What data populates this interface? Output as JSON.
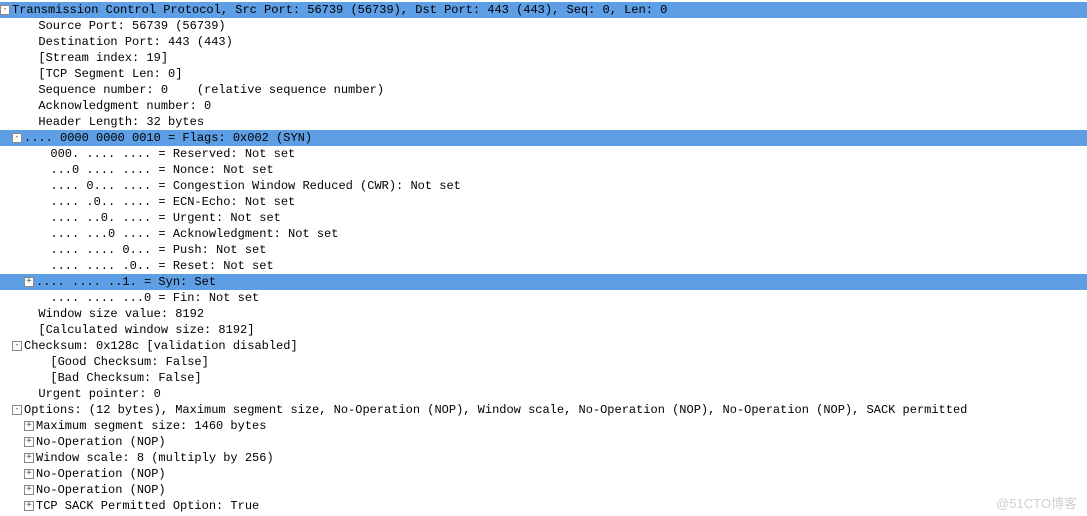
{
  "highlight_color": "#5d9ee4",
  "watermark": "@51CTO博客",
  "rows": [
    {
      "id": "tcp-header",
      "indent": 0,
      "box": "-",
      "hl": true,
      "text": "Transmission Control Protocol, Src Port: 56739 (56739), Dst Port: 443 (443), Seq: 0, Len: 0"
    },
    {
      "id": "src-port",
      "indent": 1,
      "box": "",
      "hl": false,
      "text": "  Source Port: 56739 (56739)"
    },
    {
      "id": "dst-port",
      "indent": 1,
      "box": "",
      "hl": false,
      "text": "  Destination Port: 443 (443)"
    },
    {
      "id": "stream-index",
      "indent": 1,
      "box": "",
      "hl": false,
      "text": "  [Stream index: 19]"
    },
    {
      "id": "seg-len",
      "indent": 1,
      "box": "",
      "hl": false,
      "text": "  [TCP Segment Len: 0]"
    },
    {
      "id": "seq-num",
      "indent": 1,
      "box": "",
      "hl": false,
      "text": "  Sequence number: 0    (relative sequence number)"
    },
    {
      "id": "ack-num",
      "indent": 1,
      "box": "",
      "hl": false,
      "text": "  Acknowledgment number: 0"
    },
    {
      "id": "hdr-len",
      "indent": 1,
      "box": "",
      "hl": false,
      "text": "  Header Length: 32 bytes"
    },
    {
      "id": "flags",
      "indent": 1,
      "box": "-",
      "hl": true,
      "text": ".... 0000 0000 0010 = Flags: 0x002 (SYN)"
    },
    {
      "id": "flag-reserved",
      "indent": 2,
      "box": "",
      "hl": false,
      "text": "  000. .... .... = Reserved: Not set"
    },
    {
      "id": "flag-nonce",
      "indent": 2,
      "box": "",
      "hl": false,
      "text": "  ...0 .... .... = Nonce: Not set"
    },
    {
      "id": "flag-cwr",
      "indent": 2,
      "box": "",
      "hl": false,
      "text": "  .... 0... .... = Congestion Window Reduced (CWR): Not set"
    },
    {
      "id": "flag-ece",
      "indent": 2,
      "box": "",
      "hl": false,
      "text": "  .... .0.. .... = ECN-Echo: Not set"
    },
    {
      "id": "flag-urg",
      "indent": 2,
      "box": "",
      "hl": false,
      "text": "  .... ..0. .... = Urgent: Not set"
    },
    {
      "id": "flag-ack",
      "indent": 2,
      "box": "",
      "hl": false,
      "text": "  .... ...0 .... = Acknowledgment: Not set"
    },
    {
      "id": "flag-psh",
      "indent": 2,
      "box": "",
      "hl": false,
      "text": "  .... .... 0... = Push: Not set"
    },
    {
      "id": "flag-rst",
      "indent": 2,
      "box": "",
      "hl": false,
      "text": "  .... .... .0.. = Reset: Not set"
    },
    {
      "id": "flag-syn",
      "indent": 2,
      "box": "+",
      "hl": true,
      "text": ".... .... ..1. = Syn: Set"
    },
    {
      "id": "flag-fin",
      "indent": 2,
      "box": "",
      "hl": false,
      "text": "  .... .... ...0 = Fin: Not set"
    },
    {
      "id": "win-size",
      "indent": 1,
      "box": "",
      "hl": false,
      "text": "  Window size value: 8192"
    },
    {
      "id": "calc-win",
      "indent": 1,
      "box": "",
      "hl": false,
      "text": "  [Calculated window size: 8192]"
    },
    {
      "id": "checksum",
      "indent": 1,
      "box": "-",
      "hl": false,
      "text": "Checksum: 0x128c [validation disabled]"
    },
    {
      "id": "good-cksum",
      "indent": 2,
      "box": "",
      "hl": false,
      "text": "  [Good Checksum: False]"
    },
    {
      "id": "bad-cksum",
      "indent": 2,
      "box": "",
      "hl": false,
      "text": "  [Bad Checksum: False]"
    },
    {
      "id": "urg-ptr",
      "indent": 1,
      "box": "",
      "hl": false,
      "text": "  Urgent pointer: 0"
    },
    {
      "id": "options",
      "indent": 1,
      "box": "-",
      "hl": false,
      "text": "Options: (12 bytes), Maximum segment size, No-Operation (NOP), Window scale, No-Operation (NOP), No-Operation (NOP), SACK permitted"
    },
    {
      "id": "opt-mss",
      "indent": 2,
      "box": "+",
      "hl": false,
      "text": "Maximum segment size: 1460 bytes"
    },
    {
      "id": "opt-nop1",
      "indent": 2,
      "box": "+",
      "hl": false,
      "text": "No-Operation (NOP)"
    },
    {
      "id": "opt-wscale",
      "indent": 2,
      "box": "+",
      "hl": false,
      "text": "Window scale: 8 (multiply by 256)"
    },
    {
      "id": "opt-nop2",
      "indent": 2,
      "box": "+",
      "hl": false,
      "text": "No-Operation (NOP)"
    },
    {
      "id": "opt-nop3",
      "indent": 2,
      "box": "+",
      "hl": false,
      "text": "No-Operation (NOP)"
    },
    {
      "id": "opt-sack",
      "indent": 2,
      "box": "+",
      "hl": false,
      "text": "TCP SACK Permitted Option: True"
    }
  ]
}
